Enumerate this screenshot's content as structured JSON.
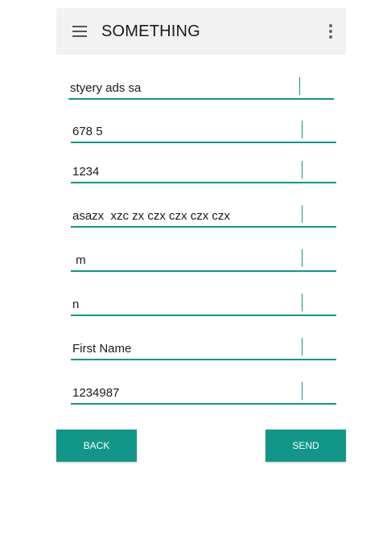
{
  "app_bar": {
    "title": "SOMETHING",
    "menu_icon": "hamburger-menu-icon",
    "overflow_icon": "more-vert-icon"
  },
  "form": {
    "fields": [
      {
        "value": "styery ads sa"
      },
      {
        "value": "678 5"
      },
      {
        "value": "1234"
      },
      {
        "value": "asazx  xzc zx czx czx czx czx"
      },
      {
        "value": " m"
      },
      {
        "value": "n"
      },
      {
        "value": "First Name"
      },
      {
        "value": "1234987"
      }
    ]
  },
  "buttons": {
    "back_label": "BACK",
    "send_label": "SEND"
  },
  "colors": {
    "accent": "#129688",
    "app_bar_bg": "#f2f2f2"
  }
}
